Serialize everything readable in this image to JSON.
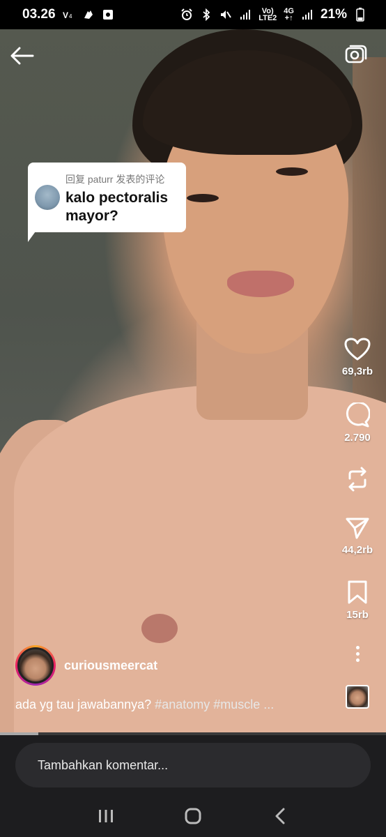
{
  "status_bar": {
    "time": "03.26",
    "battery": "21%",
    "network_top": "Vo)",
    "network_bottom": "LTE2",
    "data_top": "4G",
    "data_bottom": "+↑"
  },
  "reply": {
    "header": "回复 paturr 发表的评论",
    "text": "kalo pectoralis mayor?"
  },
  "actions": {
    "likes": "69,3rb",
    "comments": "2.790",
    "shares": "44,2rb",
    "saves": "15rb"
  },
  "creator": {
    "username": "curiousmeercat",
    "caption_text": "ada yg tau jawabannya?",
    "caption_tags": "#anatomy #muscle ..."
  },
  "progress": {
    "fraction": 0.1
  },
  "comment_input": {
    "placeholder": "Tambahkan komentar..."
  },
  "icons": {
    "back": "arrow-left-icon",
    "camera": "camera-icon",
    "like": "heart-icon",
    "comment": "speech-bubble-icon",
    "repost": "repost-icon",
    "share": "send-icon",
    "save": "bookmark-icon",
    "more": "more-vertical-icon"
  }
}
